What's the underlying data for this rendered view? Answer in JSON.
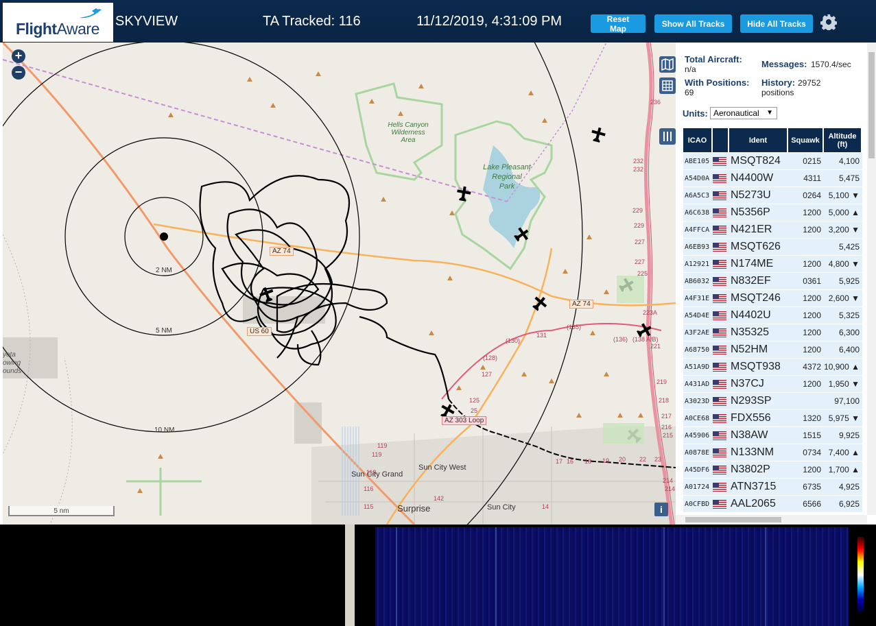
{
  "header": {
    "logo_text_bold": "Flight",
    "logo_text_light": "Aware",
    "title": "SKYVIEW",
    "tracked": "TA Tracked: 116",
    "clock": "11/12/2019, 4:31:09 PM",
    "buttons": {
      "reset": "Reset Map",
      "show": "Show All Tracks",
      "hide": "Hide All Tracks"
    }
  },
  "map": {
    "zoom_in": "+",
    "zoom_out": "−",
    "scale_label": "5 nm",
    "info": "i",
    "range_labels": [
      "2 NM",
      "5 NM",
      "10 NM"
    ],
    "places": [
      "Hells Canyon Wilderness Area",
      "Lake Pleasant Regional Park",
      "Sun City Grand",
      "Sun City West",
      "Surprise",
      "Sun City"
    ],
    "roads": [
      "AZ 74",
      "AZ 74",
      "US 60",
      "AZ 303 Loop"
    ],
    "place_lines": {
      "hells": [
        "Hells Canyon",
        "Wilderness",
        "Area"
      ],
      "lake": [
        "Lake Pleasant",
        "Regional",
        "Park"
      ],
      "coyote": [
        "yota",
        "owing",
        "ounds"
      ]
    },
    "milestones": [
      "236",
      "232",
      "232",
      "229",
      "229",
      "227",
      "227",
      "225",
      "223A",
      "221",
      "219",
      "218",
      "217",
      "216",
      "215",
      "214",
      "214",
      "(138 A/B)",
      "(136)",
      "(135)",
      "(130)",
      "131",
      "(128)",
      "127",
      "125",
      "25",
      "119",
      "119",
      "118",
      "116",
      "115",
      "142",
      "17",
      "16",
      "18",
      "19",
      "20",
      "22",
      "23",
      "14"
    ]
  },
  "panel": {
    "total_aircraft_label": "Total Aircraft:",
    "total_aircraft_value": "n/a",
    "with_positions_label": "With Positions:",
    "with_positions_value": "69",
    "messages_label": "Messages:",
    "messages_value": "1570.4/sec",
    "history_label": "History:",
    "history_value": "29752",
    "history_unit": "positions",
    "units_label": "Units:",
    "units_value": "Aeronautical",
    "columns": [
      "ICAO",
      "",
      "Ident",
      "Squawk",
      "Altitude (ft)"
    ],
    "rows": [
      {
        "icao": "ABE105",
        "ident": "MSQT824",
        "squawk": "0215",
        "alt": "4,100"
      },
      {
        "icao": "A54D0A",
        "ident": "N4400W",
        "squawk": "4311",
        "alt": "5,475"
      },
      {
        "icao": "A6A5C3",
        "ident": "N5273U",
        "squawk": "0264",
        "alt": "5,100 ▼"
      },
      {
        "icao": "A6C638",
        "ident": "N5356P",
        "squawk": "1200",
        "alt": "5,000 ▲"
      },
      {
        "icao": "A4FFCA",
        "ident": "N421ER",
        "squawk": "1200",
        "alt": "3,200 ▼"
      },
      {
        "icao": "A6EB93",
        "ident": "MSQT626",
        "squawk": "",
        "alt": "5,425"
      },
      {
        "icao": "A12921",
        "ident": "N174ME",
        "squawk": "1200",
        "alt": "4,800 ▼"
      },
      {
        "icao": "AB6032",
        "ident": "N832EF",
        "squawk": "0361",
        "alt": "5,925"
      },
      {
        "icao": "A4F31E",
        "ident": "MSQT246",
        "squawk": "1200",
        "alt": "2,600 ▼"
      },
      {
        "icao": "A54D4E",
        "ident": "N4402U",
        "squawk": "1200",
        "alt": "5,325"
      },
      {
        "icao": "A3F2AE",
        "ident": "N35325",
        "squawk": "1200",
        "alt": "6,300"
      },
      {
        "icao": "A68750",
        "ident": "N52HM",
        "squawk": "1200",
        "alt": "6,400"
      },
      {
        "icao": "A51A9D",
        "ident": "MSQT938",
        "squawk": "4372",
        "alt": "10,900 ▲"
      },
      {
        "icao": "A431AD",
        "ident": "N37CJ",
        "squawk": "1200",
        "alt": "1,950 ▼"
      },
      {
        "icao": "A3023D",
        "ident": "N293SP",
        "squawk": "",
        "alt": "97,100"
      },
      {
        "icao": "A0CE68",
        "ident": "FDX556",
        "squawk": "1320",
        "alt": "5,975 ▼"
      },
      {
        "icao": "A45906",
        "ident": "N38AW",
        "squawk": "1515",
        "alt": "9,925"
      },
      {
        "icao": "A0878E",
        "ident": "N133NM",
        "squawk": "0734",
        "alt": "7,400 ▲"
      },
      {
        "icao": "A45DF6",
        "ident": "N3802P",
        "squawk": "1200",
        "alt": "1,700 ▲"
      },
      {
        "icao": "A01724",
        "ident": "ATN3715",
        "squawk": "6735",
        "alt": "4,925"
      },
      {
        "icao": "A0CFBD",
        "ident": "AAL2065",
        "squawk": "6566",
        "alt": "6,925"
      }
    ]
  },
  "colors": {
    "header_bg": "#0b2a4d",
    "button": "#1a9ae0",
    "row_bg": "#e4f0fa",
    "accent": "#1d3f6e"
  }
}
